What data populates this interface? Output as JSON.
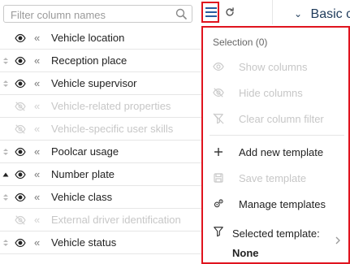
{
  "search": {
    "placeholder": "Filter column names"
  },
  "columns": [
    {
      "label": "Vehicle location",
      "enabled": true,
      "handle": "none"
    },
    {
      "label": "Reception place",
      "enabled": true,
      "handle": "drag"
    },
    {
      "label": "Vehicle supervisor",
      "enabled": true,
      "handle": "drag"
    },
    {
      "label": "Vehicle-related properties",
      "enabled": false,
      "handle": "none"
    },
    {
      "label": "Vehicle-specific user skills",
      "enabled": false,
      "handle": "none"
    },
    {
      "label": "Poolcar usage",
      "enabled": true,
      "handle": "drag"
    },
    {
      "label": "Number plate",
      "enabled": true,
      "handle": "sort-asc"
    },
    {
      "label": "Vehicle class",
      "enabled": true,
      "handle": "drag"
    },
    {
      "label": "External driver identification",
      "enabled": false,
      "handle": "none"
    },
    {
      "label": "Vehicle status",
      "enabled": true,
      "handle": "drag"
    }
  ],
  "header": {
    "section_title": "Basic c"
  },
  "menu": {
    "selection_label": "Selection (0)",
    "items": [
      {
        "label": "Show columns",
        "enabled": false,
        "icon": "eye-icon"
      },
      {
        "label": "Hide columns",
        "enabled": false,
        "icon": "eye-off-icon"
      },
      {
        "label": "Clear column filter",
        "enabled": false,
        "icon": "filter-clear-icon"
      },
      {
        "label": "Add new template",
        "enabled": true,
        "icon": "plus-icon"
      },
      {
        "label": "Save template",
        "enabled": false,
        "icon": "save-icon"
      },
      {
        "label": "Manage templates",
        "enabled": true,
        "icon": "gears-icon"
      }
    ],
    "selected_template_label": "Selected template:",
    "selected_template_value": "None"
  },
  "colors": {
    "highlight_red": "#e0141e",
    "disabled_text": "#c7c7c7",
    "header_blue": "#1e3a5a"
  }
}
